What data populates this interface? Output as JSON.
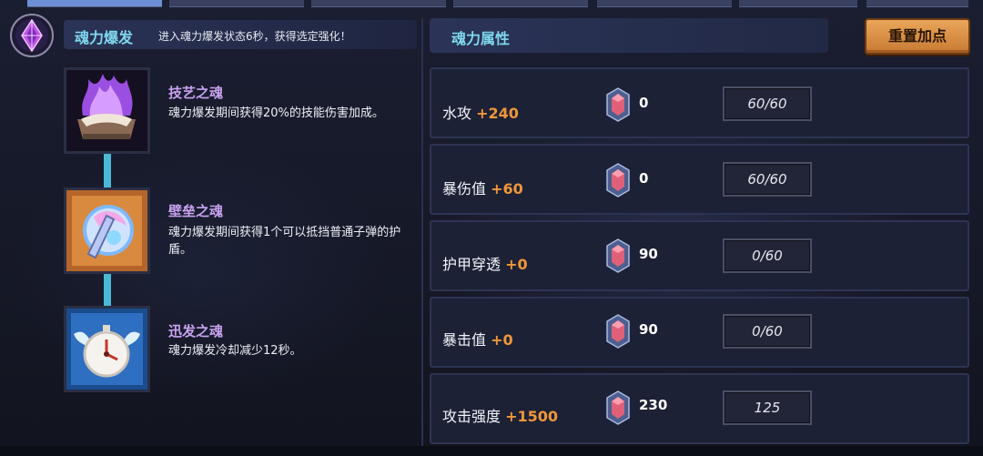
{
  "soul_burst": {
    "title": "魂力爆发",
    "description": "进入魂力爆发状态6秒，获得选定强化！"
  },
  "souls": [
    {
      "name": "技艺之魂",
      "description": "魂力爆发期间获得20%的技能伤害加成。",
      "icon": "purple-flame-chest-icon"
    },
    {
      "name": "壁垒之魂",
      "description": "魂力爆发期间获得1个可以抵挡普通子弹的护盾。",
      "icon": "shield-orb-icon"
    },
    {
      "name": "迅发之魂",
      "description": "魂力爆发冷却减少12秒。",
      "icon": "winged-clock-icon"
    }
  ],
  "attributes": {
    "title": "魂力属性",
    "reset_label": "重置加点",
    "rows": [
      {
        "name": "水攻",
        "bonus": "+240",
        "cost": "0",
        "level": "60/60"
      },
      {
        "name": "暴伤值",
        "bonus": "+60",
        "cost": "0",
        "level": "60/60"
      },
      {
        "name": "护甲穿透",
        "bonus": "+0",
        "cost": "90",
        "level": "0/60"
      },
      {
        "name": "暴击值",
        "bonus": "+0",
        "cost": "90",
        "level": "0/60"
      },
      {
        "name": "攻击强度",
        "bonus": "+1500",
        "cost": "230",
        "level": "125"
      }
    ]
  },
  "colors": {
    "accent_cyan": "#7fd8ee",
    "soul_name": "#c9a2f0",
    "bonus_orange": "#f0973a",
    "button_orange": "#e9a65b"
  }
}
